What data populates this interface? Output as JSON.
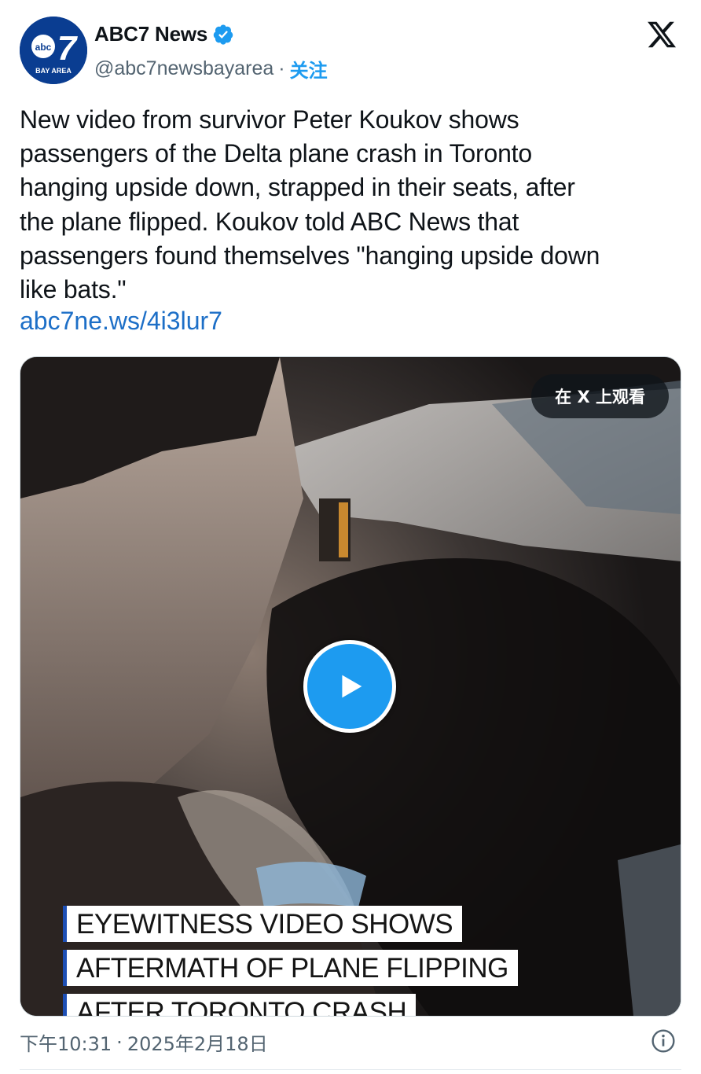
{
  "account": {
    "name": "ABC7 News",
    "handle": "@abc7newsbayarea",
    "separator": "·",
    "follow_label": "关注",
    "avatar_logo_text": "abc",
    "avatar_logo_number": "7",
    "avatar_subtitle": "BAY AREA"
  },
  "tweet": {
    "text_lines": [
      "New video from survivor Peter Koukov shows",
      "passengers of the Delta plane crash in Toronto",
      "hanging upside down, strapped in their seats, after",
      "the plane flipped. Koukov told ABC News that",
      "passengers found themselves \"hanging upside down",
      "like bats.\""
    ],
    "link": "abc7ne.ws/4i3lur7"
  },
  "media": {
    "watch_on_x_label": "在 X 上观看",
    "caption_lines": [
      "EYEWITNESS VIDEO SHOWS",
      "AFTERMATH OF PLANE FLIPPING",
      "AFTER TORONTO CRASH"
    ]
  },
  "footer": {
    "time": "下午10:31",
    "separator": "·",
    "date": "2025年2月18日"
  },
  "colors": {
    "accent": "#1d9bf0",
    "link": "#1d6fc7",
    "muted": "#536471",
    "avatar_bg": "#0a3d91"
  },
  "icons": {
    "verified": "verified-badge-icon",
    "x_logo": "x-logo-icon",
    "play": "play-icon",
    "info": "info-icon"
  }
}
